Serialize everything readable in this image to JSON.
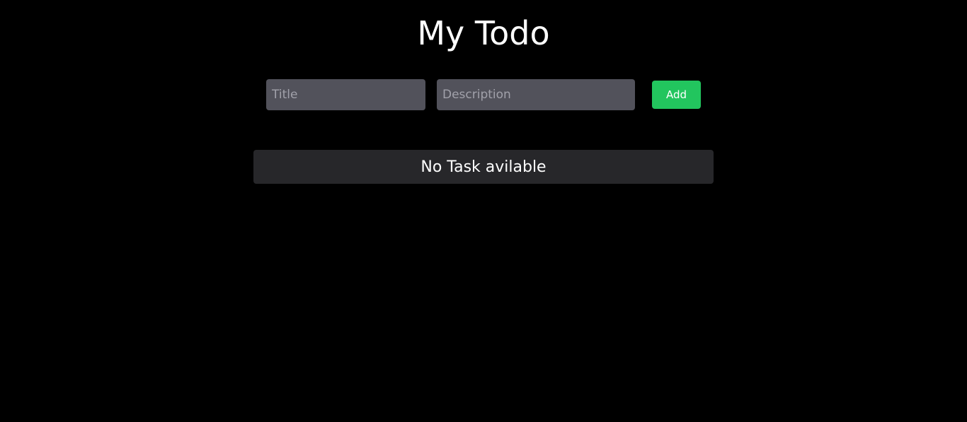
{
  "header": {
    "title": "My Todo"
  },
  "form": {
    "title_placeholder": "Title",
    "description_placeholder": "Description",
    "add_label": "Add"
  },
  "tasks": {
    "empty_message": "No Task avilable"
  },
  "colors": {
    "background": "#000000",
    "input": "#52525b",
    "accent": "#22c55e",
    "card": "#27272a"
  }
}
